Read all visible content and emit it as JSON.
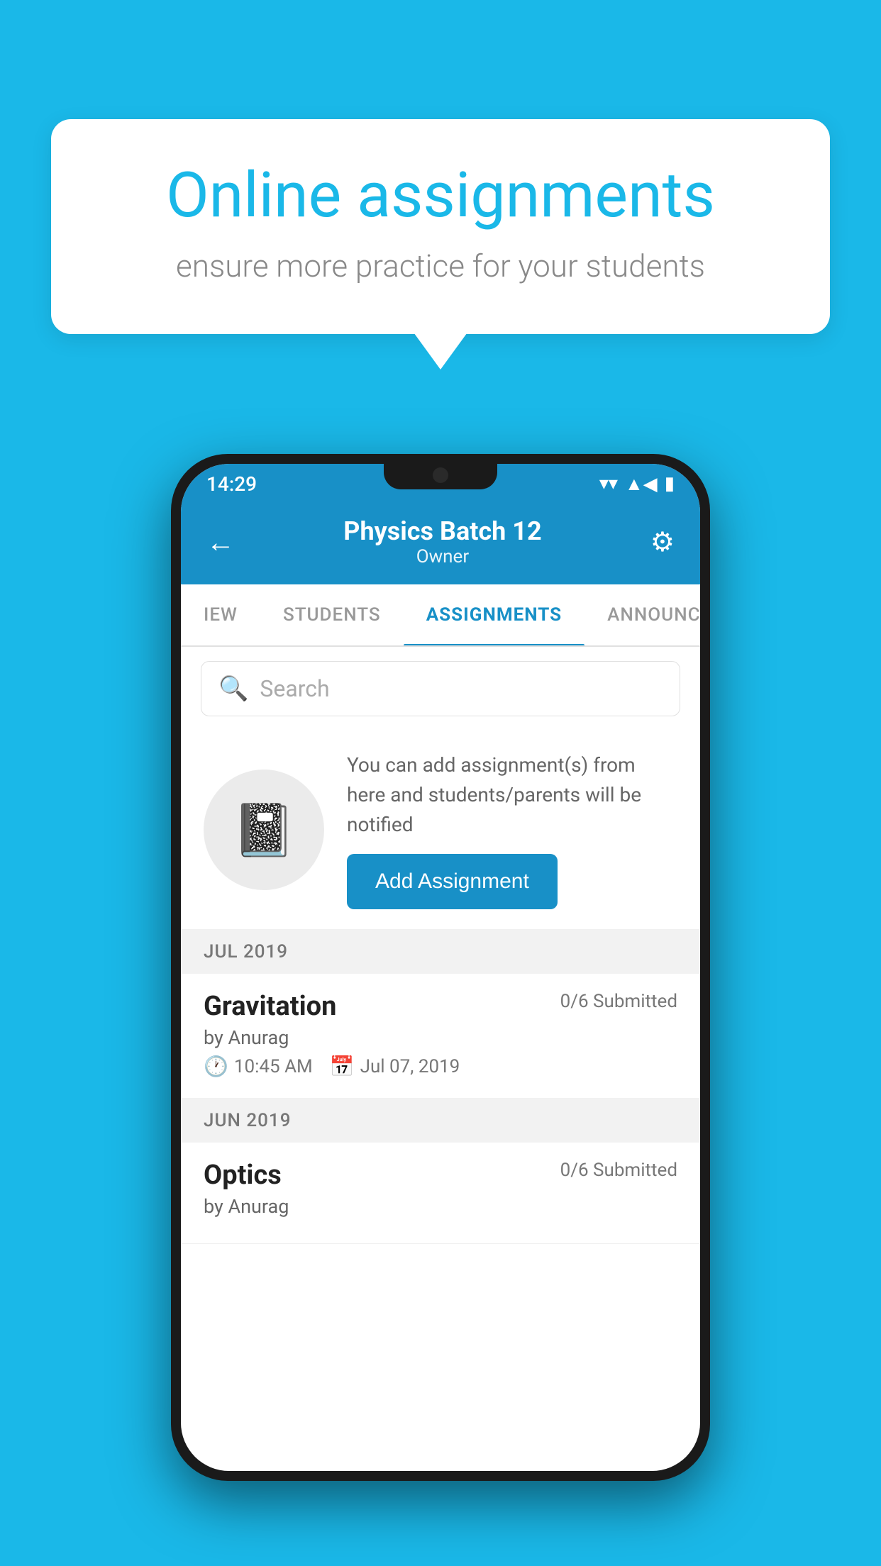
{
  "background": {
    "color": "#1ab8e8"
  },
  "speech_bubble": {
    "title": "Online assignments",
    "subtitle": "ensure more practice for your students"
  },
  "phone": {
    "status_bar": {
      "time": "14:29",
      "wifi_icon": "▾",
      "signal_icon": "▲",
      "battery_icon": "▮"
    },
    "header": {
      "back_icon": "←",
      "title": "Physics Batch 12",
      "subtitle": "Owner",
      "settings_icon": "⚙"
    },
    "tabs": [
      {
        "label": "IEW",
        "active": false
      },
      {
        "label": "STUDENTS",
        "active": false
      },
      {
        "label": "ASSIGNMENTS",
        "active": true
      },
      {
        "label": "ANNOUNCEM",
        "active": false
      }
    ],
    "search": {
      "placeholder": "Search"
    },
    "info_card": {
      "description": "You can add assignment(s) from here and students/parents will be notified",
      "add_button": "Add Assignment"
    },
    "sections": [
      {
        "label": "JUL 2019",
        "assignments": [
          {
            "title": "Gravitation",
            "submitted": "0/6 Submitted",
            "author": "by Anurag",
            "time": "10:45 AM",
            "date": "Jul 07, 2019"
          }
        ]
      },
      {
        "label": "JUN 2019",
        "assignments": [
          {
            "title": "Optics",
            "submitted": "0/6 Submitted",
            "author": "by Anurag",
            "time": "",
            "date": ""
          }
        ]
      }
    ]
  }
}
